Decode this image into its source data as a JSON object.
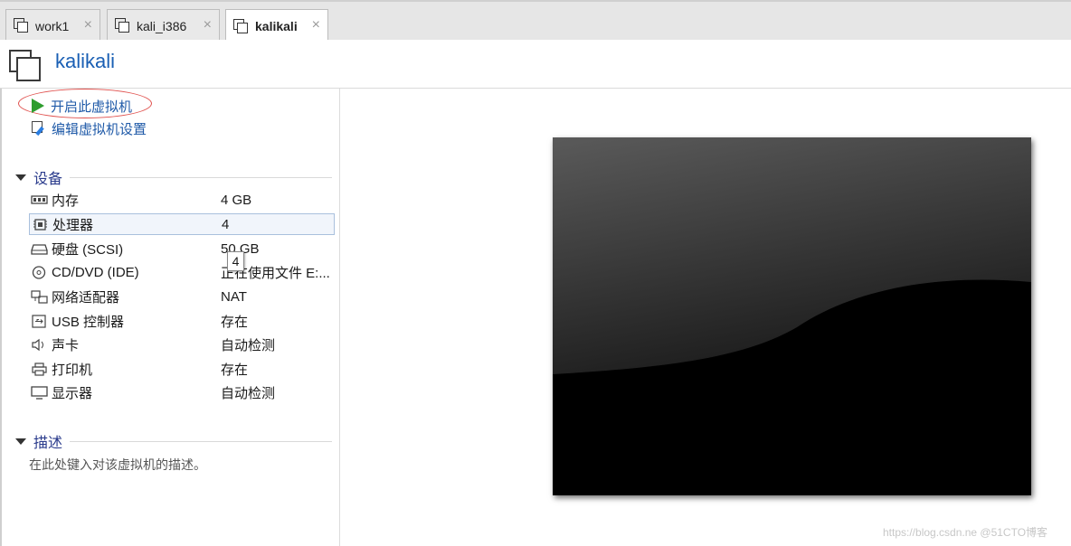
{
  "tabs": [
    {
      "label": "work1",
      "close": "×"
    },
    {
      "label": "kali_i386",
      "close": "×"
    },
    {
      "label": "kalikali",
      "close": "×"
    }
  ],
  "header": {
    "title": "kalikali"
  },
  "actions": {
    "power_on": "开启此虚拟机",
    "edit_settings": "编辑虚拟机设置"
  },
  "devices_section": {
    "title": "设备"
  },
  "devices": [
    {
      "name": "内存",
      "value": "4 GB",
      "icon": "memory-icon"
    },
    {
      "name": "处理器",
      "value": "4",
      "icon": "processor-icon"
    },
    {
      "name": "硬盘 (SCSI)",
      "value": "50 GB",
      "icon": "hard-disk-icon"
    },
    {
      "name": "CD/DVD (IDE)",
      "value": "正在使用文件 E:...",
      "icon": "cd-dvd-icon"
    },
    {
      "name": "网络适配器",
      "value": "NAT",
      "icon": "network-adapter-icon"
    },
    {
      "name": "USB 控制器",
      "value": "存在",
      "icon": "usb-icon"
    },
    {
      "name": "声卡",
      "value": "自动检测",
      "icon": "speaker-icon"
    },
    {
      "name": "打印机",
      "value": "存在",
      "icon": "printer-icon"
    },
    {
      "name": "显示器",
      "value": "自动检测",
      "icon": "monitor-icon"
    }
  ],
  "tooltip": "4",
  "description_section": {
    "title": "描述",
    "placeholder": "在此处键入对该虚拟机的描述。"
  },
  "watermark": "https://blog.csdn.ne @51CTO博客",
  "colors": {
    "accent_link": "#1f5aa8",
    "play_green": "#2e9d2e",
    "section_title": "#2a3b8c",
    "highlight_ellipse": "#e0504d"
  }
}
